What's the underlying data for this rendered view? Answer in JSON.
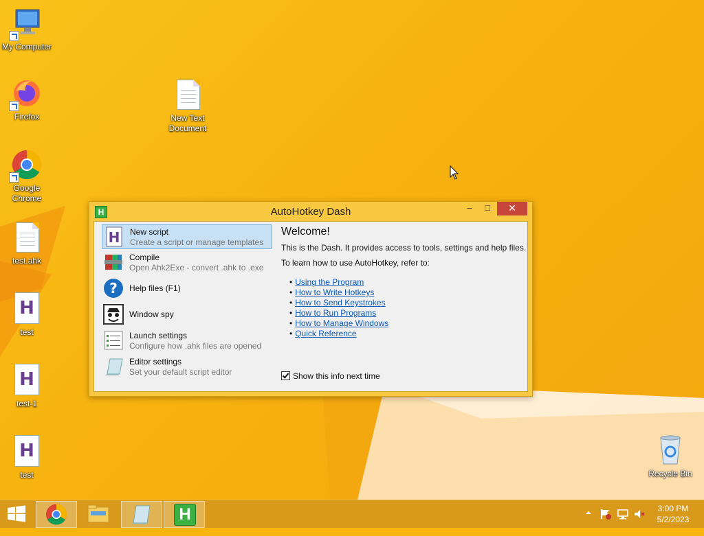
{
  "desktop": {
    "icons": [
      {
        "label": "My Computer",
        "icon": "computer-icon"
      },
      {
        "label": "Firefox",
        "icon": "firefox-icon"
      },
      {
        "label": "New Text Document",
        "icon": "text-document-icon"
      },
      {
        "label": "Google Chrome",
        "icon": "chrome-icon"
      },
      {
        "label": "test.ahk",
        "icon": "text-document-icon"
      },
      {
        "label": "test",
        "icon": "ahk-script-icon"
      },
      {
        "label": "test-1",
        "icon": "ahk-script-icon"
      },
      {
        "label": "test",
        "icon": "ahk-script-icon"
      },
      {
        "label": "Recycle Bin",
        "icon": "recycle-bin-icon"
      }
    ]
  },
  "window": {
    "title": "AutoHotkey Dash",
    "app_icon_letter": "H",
    "minimize_label": "–",
    "maximize_label": "□",
    "close_label": "✕",
    "menu": [
      {
        "title": "New script",
        "desc": "Create a script or manage templates",
        "icon": "new-script-icon",
        "selected": true
      },
      {
        "title": "Compile",
        "desc": "Open Ahk2Exe - convert .ahk to .exe",
        "icon": "compile-icon"
      },
      {
        "title": "Help files (F1)",
        "desc": "",
        "icon": "help-icon"
      },
      {
        "title": "Window spy",
        "desc": "",
        "icon": "window-spy-icon"
      },
      {
        "title": "Launch settings",
        "desc": "Configure how .ahk files are opened",
        "icon": "launch-settings-icon"
      },
      {
        "title": "Editor settings",
        "desc": "Set your default script editor",
        "icon": "editor-settings-icon"
      }
    ],
    "welcome": {
      "heading": "Welcome!",
      "intro": "This is the Dash. It provides access to tools, settings and help files.",
      "refer": "To learn how to use AutoHotkey, refer to:",
      "links": [
        "Using the Program",
        "How to Write Hotkeys",
        "How to Send Keystrokes",
        "How to Run Programs",
        "How to Manage Windows",
        "Quick Reference"
      ],
      "show_info_label": "Show this info next time",
      "show_info_checked": true
    }
  },
  "taskbar": {
    "buttons": [
      "start-icon",
      "chrome-icon",
      "file-explorer-icon",
      "notepad-icon",
      "autohotkey-icon"
    ],
    "ahk_letter": "H",
    "clock_time": "3:00 PM",
    "clock_date": "5/2/2023"
  },
  "colors": {
    "desktop": "#f7b50e",
    "taskbar": "#d99a1c",
    "link": "#0b58b6",
    "close": "#c7463b",
    "selection": "#c7e0f4"
  }
}
